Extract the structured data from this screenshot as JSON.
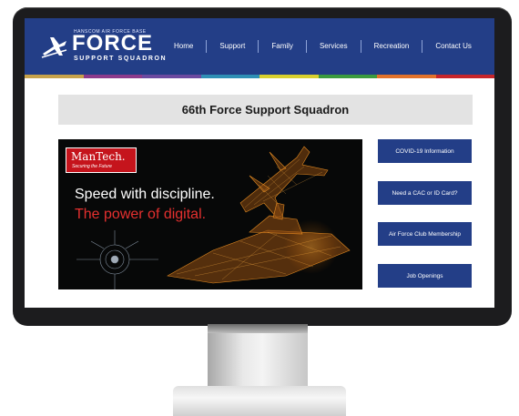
{
  "logo": {
    "small_top": "HANSCOM AIR FORCE BASE",
    "big": "FORCE",
    "small_bottom": "SUPPORT SQUADRON"
  },
  "nav": {
    "items": [
      "Home",
      "Support",
      "Family",
      "Services",
      "Recreation",
      "Contact Us"
    ]
  },
  "colors": {
    "header": "#233e87",
    "stripe": [
      "#c7a24a",
      "#8c3b8c",
      "#6b4aa0",
      "#2f8fb5",
      "#d8d02e",
      "#3b9b3f",
      "#e2722a",
      "#c7252b"
    ]
  },
  "page": {
    "title": "66th Force Support Squadron"
  },
  "ad": {
    "brand": "ManTech.",
    "tagline": "Securing the Future",
    "line1": "Speed with discipline.",
    "line2": "The power of digital."
  },
  "sidebar": {
    "buttons": [
      {
        "label": "COVID-19 Information"
      },
      {
        "label": "Need a CAC or ID Card?"
      },
      {
        "label": "Air Force Club Membership"
      },
      {
        "label": "Job Openings"
      }
    ]
  }
}
